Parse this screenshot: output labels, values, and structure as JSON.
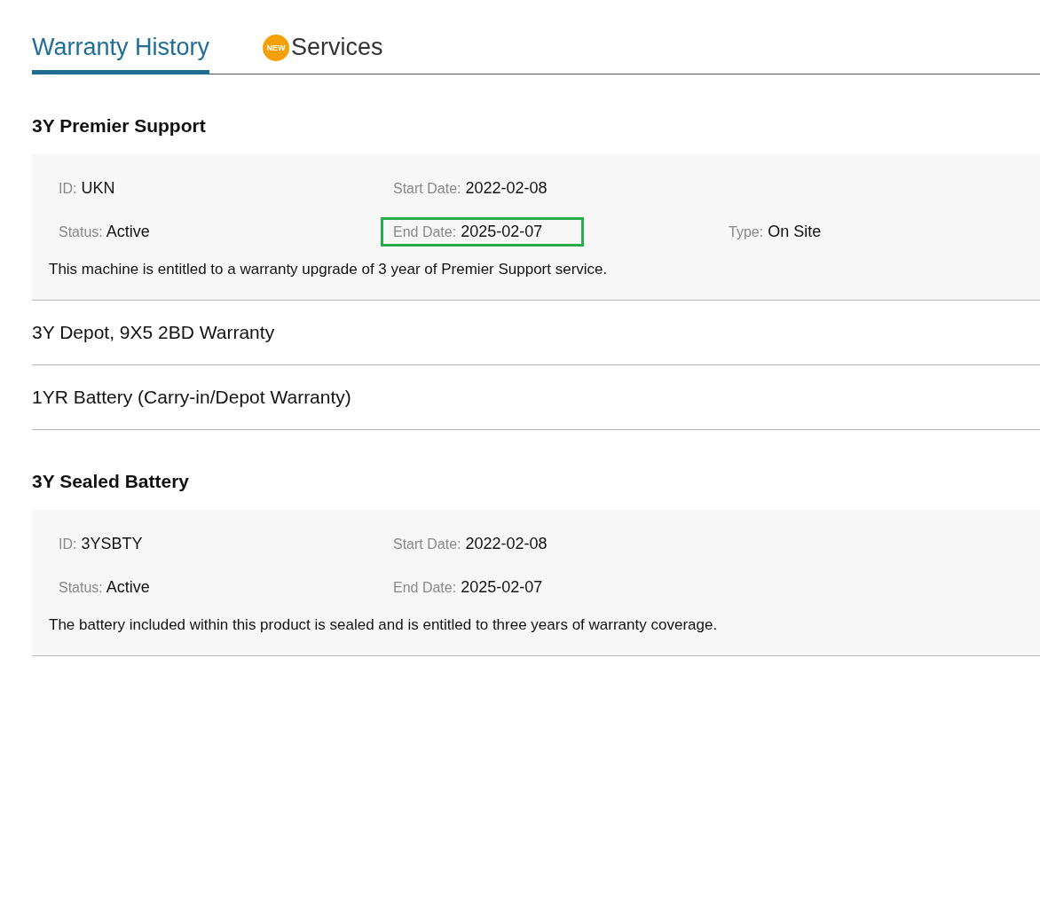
{
  "tabs": [
    {
      "label": "Warranty History",
      "selected": true
    },
    {
      "label": "Services",
      "selected": false,
      "badge": "NEW"
    }
  ],
  "warranties": [
    {
      "title": "3Y Premier Support",
      "expanded": true,
      "rows": [
        [
          {
            "label": "ID:",
            "value": "UKN",
            "highlighted": false
          },
          {
            "label": "Start Date:",
            "value": "2022-02-08",
            "highlighted": false
          }
        ],
        [
          {
            "label": "Status:",
            "value": "Active",
            "highlighted": false
          },
          {
            "label": "End Date:",
            "value": "2025-02-07",
            "highlighted": true
          },
          {
            "label": "Type:",
            "value": "On Site",
            "highlighted": false
          }
        ]
      ],
      "description": "This machine is entitled to a warranty upgrade of 3 year of Premier Support service."
    },
    {
      "title": "3Y Depot, 9X5 2BD Warranty",
      "expanded": false
    },
    {
      "title": "1YR Battery (Carry-in/Depot Warranty)",
      "expanded": false
    },
    {
      "title": "3Y Sealed Battery",
      "expanded": true,
      "rows": [
        [
          {
            "label": "ID:",
            "value": "3YSBTY",
            "highlighted": false
          },
          {
            "label": "Start Date:",
            "value": "2022-02-08",
            "highlighted": false
          }
        ],
        [
          {
            "label": "Status:",
            "value": "Active",
            "highlighted": false
          },
          {
            "label": "End Date:",
            "value": "2025-02-07",
            "highlighted": false
          }
        ]
      ],
      "description": "The battery included within this product is sealed and is entitled to three years of warranty coverage."
    }
  ]
}
